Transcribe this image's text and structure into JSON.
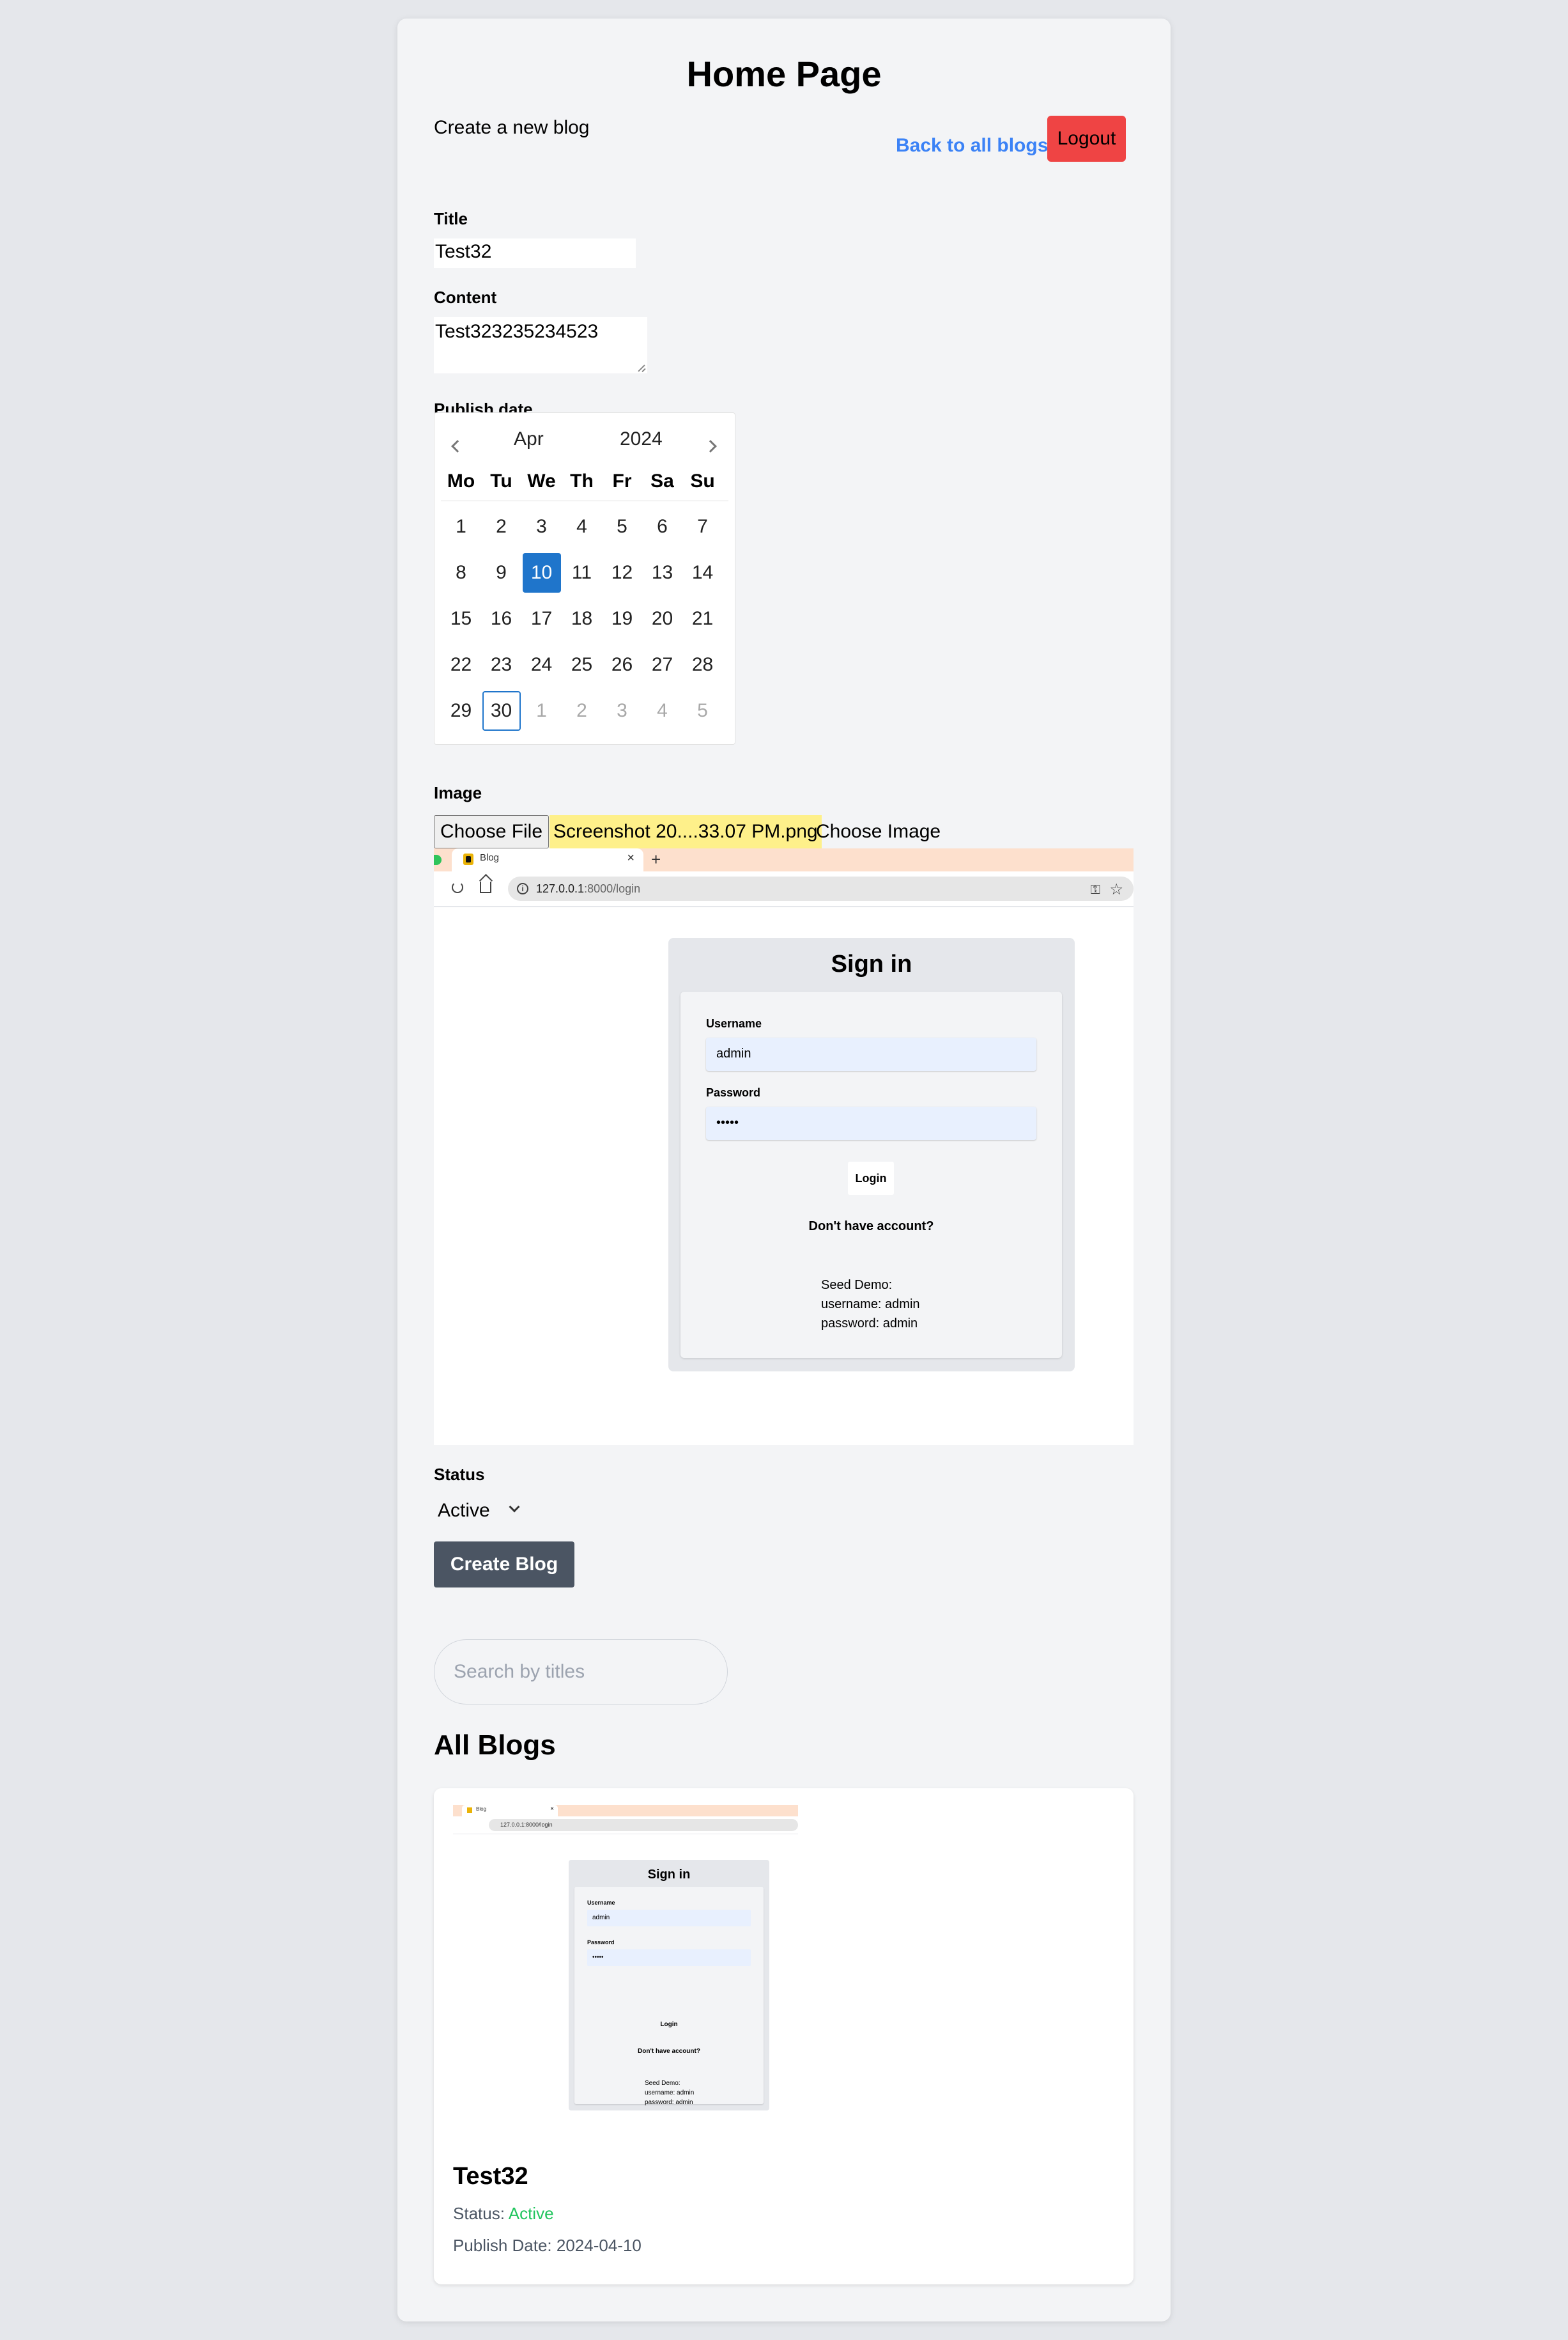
{
  "page": {
    "title": "Home Page",
    "subtitle": "Create a new blog",
    "back_link": "Back to all blogs",
    "logout": "Logout"
  },
  "form": {
    "title_label": "Title",
    "title_value": "Test32",
    "content_label": "Content",
    "content_value": "Test323235234523",
    "publish_label": "Publish date",
    "calendar": {
      "month": "Apr",
      "year": "2024",
      "weekdays": [
        "Mo",
        "Tu",
        "We",
        "Th",
        "Fr",
        "Sa",
        "Su"
      ],
      "days": [
        "1",
        "2",
        "3",
        "4",
        "5",
        "6",
        "7",
        "8",
        "9",
        "10",
        "11",
        "12",
        "13",
        "14",
        "15",
        "16",
        "17",
        "18",
        "19",
        "20",
        "21",
        "22",
        "23",
        "24",
        "25",
        "26",
        "27",
        "28",
        "29",
        "30",
        "1",
        "2",
        "3",
        "4",
        "5"
      ],
      "selected_day": "10",
      "today_day": "30"
    },
    "image_label": "Image",
    "choose_file": "Choose File",
    "file_name": "Screenshot 20....33.07 PM.png",
    "choose_image": "Choose Image",
    "status_label": "Status",
    "status_value": "Active",
    "submit": "Create Blog"
  },
  "preview": {
    "tab_title": "Blog",
    "tab_close": "×",
    "new_tab": "+",
    "url_host": "127.0.0.1",
    "url_rest": ":8000/login",
    "signin_title": "Sign in",
    "username_label": "Username",
    "username_value": "admin",
    "password_label": "Password",
    "password_value": "•••••",
    "login_button": "Login",
    "no_account": "Don't have account?",
    "seed_line1": "Seed Demo:",
    "seed_line2": "username: admin",
    "seed_line3": "password: admin"
  },
  "search": {
    "placeholder": "Search by titles"
  },
  "blogs": {
    "heading": "All Blogs",
    "items": [
      {
        "title": "Test32",
        "status_label": "Status:",
        "status_value": "Active",
        "date_label": "Publish Date:",
        "date_value": "2024-04-10",
        "thumb_url": "127.0.0.1:8000/login"
      }
    ]
  },
  "colors": {
    "accent": "#3b82f6",
    "logout": "#ef4444",
    "selected_day": "#1f75cb",
    "file_highlight": "#fef08a",
    "status_active": "#22c55e",
    "create_button": "#4b5563"
  }
}
